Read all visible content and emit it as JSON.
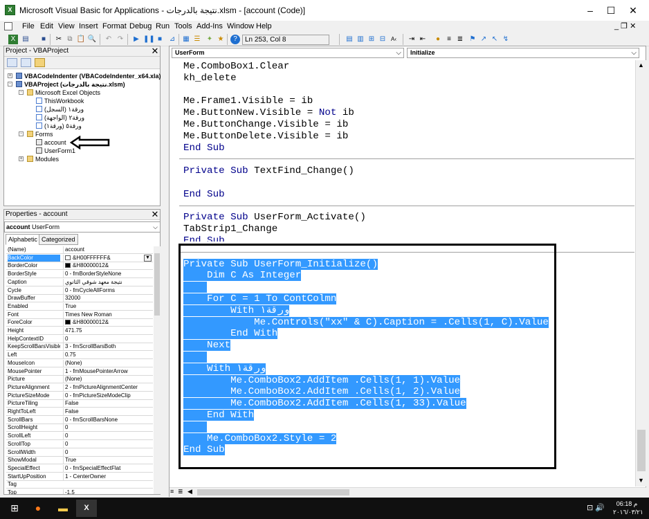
{
  "window": {
    "title": "Microsoft Visual Basic for Applications - نتيجة بالدرجات.xlsm - [account (Code)]",
    "icon_letter": "X",
    "controls": [
      "–",
      "☐",
      "✕"
    ]
  },
  "menubar": {
    "items": [
      "File",
      "Edit",
      "View",
      "Insert",
      "Format",
      "Debug",
      "Run",
      "Tools",
      "Add-Ins",
      "Window",
      "Help"
    ],
    "mdi_controls": "_ ❐ ✕"
  },
  "toolbar": {
    "position_text": "Ln 253, Col 8",
    "icons": [
      "excel-icon",
      "insert-icon",
      "save-icon",
      "cut-icon",
      "copy-icon",
      "paste-icon",
      "find-icon",
      "undo-icon",
      "redo-icon",
      "run-icon",
      "break-icon",
      "reset-icon",
      "design-mode-icon",
      "project-explorer-icon",
      "properties-icon",
      "object-browser-icon",
      "toolbox-icon",
      "help-icon"
    ]
  },
  "project_panel": {
    "title": "Project - VBAProject",
    "close": "✕",
    "tree": [
      {
        "label": "VBACodeIndenter (VBACodeIndenter_x64.xla)",
        "bold": true,
        "level": 0,
        "expander": "+",
        "icon": "project-icon"
      },
      {
        "label": "VBAProject (نتيجة بالدرجات.xlsm)",
        "bold": true,
        "level": 0,
        "expander": "-",
        "icon": "project-icon"
      },
      {
        "label": "Microsoft Excel Objects",
        "level": 1,
        "expander": "-",
        "icon": "folder-icon"
      },
      {
        "label": "ThisWorkbook",
        "level": 2,
        "icon": "workbook-icon"
      },
      {
        "label": "ورقة١ (السجل)",
        "level": 2,
        "icon": "sheet-icon"
      },
      {
        "label": "ورقة٢ (الواجهة)",
        "level": 2,
        "icon": "sheet-icon"
      },
      {
        "label": "ورقة٥ (ورقة١)",
        "level": 2,
        "icon": "sheet-icon"
      },
      {
        "label": "Forms",
        "level": 1,
        "expander": "-",
        "icon": "folder-icon"
      },
      {
        "label": "account",
        "level": 2,
        "icon": "userform-icon"
      },
      {
        "label": "UserForm1",
        "level": 2,
        "icon": "userform-icon"
      },
      {
        "label": "Modules",
        "level": 1,
        "expander": "+",
        "icon": "folder-icon"
      }
    ]
  },
  "properties_panel": {
    "title": "Properties - account",
    "close": "✕",
    "object_name": "account",
    "object_type": "UserForm",
    "tabs": [
      "Alphabetic",
      "Categorized"
    ],
    "rows": [
      {
        "name": "(Name)",
        "value": "account"
      },
      {
        "name": "BackColor",
        "value": "&H00FFFFFF&",
        "swatch": "#ffffff",
        "selected": true
      },
      {
        "name": "BorderColor",
        "value": "&H80000012&",
        "swatch": "#000000"
      },
      {
        "name": "BorderStyle",
        "value": "0 - fmBorderStyleNone"
      },
      {
        "name": "Caption",
        "value": "نتيجة معهد شوقي الثانوي"
      },
      {
        "name": "Cycle",
        "value": "0 - fmCycleAllForms"
      },
      {
        "name": "DrawBuffer",
        "value": "32000"
      },
      {
        "name": "Enabled",
        "value": "True"
      },
      {
        "name": "Font",
        "value": "Times New Roman"
      },
      {
        "name": "ForeColor",
        "value": "&H80000012&",
        "swatch": "#000000"
      },
      {
        "name": "Height",
        "value": "471.75"
      },
      {
        "name": "HelpContextID",
        "value": "0"
      },
      {
        "name": "KeepScrollBarsVisible",
        "value": "3 - fmScrollBarsBoth"
      },
      {
        "name": "Left",
        "value": "0.75"
      },
      {
        "name": "MouseIcon",
        "value": "(None)"
      },
      {
        "name": "MousePointer",
        "value": "1 - fmMousePointerArrow"
      },
      {
        "name": "Picture",
        "value": "(None)"
      },
      {
        "name": "PictureAlignment",
        "value": "2 - fmPictureAlignmentCenter"
      },
      {
        "name": "PictureSizeMode",
        "value": "0 - fmPictureSizeModeClip"
      },
      {
        "name": "PictureTiling",
        "value": "False"
      },
      {
        "name": "RightToLeft",
        "value": "False"
      },
      {
        "name": "ScrollBars",
        "value": "0 - fmScrollBarsNone"
      },
      {
        "name": "ScrollHeight",
        "value": "0"
      },
      {
        "name": "ScrollLeft",
        "value": "0"
      },
      {
        "name": "ScrollTop",
        "value": "0"
      },
      {
        "name": "ScrollWidth",
        "value": "0"
      },
      {
        "name": "ShowModal",
        "value": "True"
      },
      {
        "name": "SpecialEffect",
        "value": "0 - fmSpecialEffectFlat"
      },
      {
        "name": "StartUpPosition",
        "value": "1 - CenterOwner"
      },
      {
        "name": "Tag",
        "value": ""
      },
      {
        "name": "Top",
        "value": "-1.5"
      }
    ]
  },
  "code_window": {
    "object_combo": "UserForm",
    "procedure_combo": "Initialize",
    "lines": [
      {
        "text": "Me.ComboBox1.Clear"
      },
      {
        "text": "kh_delete"
      },
      {
        "text": ""
      },
      {
        "text": "Me.Frame1.Visible = ib"
      },
      {
        "text": "Me.ButtonNew.Visible = Not ib",
        "kw": "Not"
      },
      {
        "text": "Me.ButtonChange.Visible = ib"
      },
      {
        "text": "Me.ButtonDelete.Visible = ib"
      },
      {
        "text": "End Sub",
        "kwline": true
      },
      {
        "divider": true
      },
      {
        "text": "Private Sub TextFind_Change()",
        "kwprefix": "Private Sub"
      },
      {
        "text": ""
      },
      {
        "text": "End Sub",
        "kwline": true
      },
      {
        "divider": true
      },
      {
        "text": "Private Sub UserForm_Activate()",
        "kwprefix": "Private Sub"
      },
      {
        "text": "TabStrip1_Change"
      },
      {
        "text": "End Sub",
        "kwline": true,
        "clipped": true
      },
      {
        "divider": true
      },
      {
        "text": "Private Sub UserForm_Initialize()",
        "hl": true
      },
      {
        "text": "    Dim C As Integer",
        "hl": true
      },
      {
        "text": "    ",
        "hl": true
      },
      {
        "text": "    For C = 1 To ContColmn",
        "hl": true
      },
      {
        "text": "        With ورقة١",
        "hl": true
      },
      {
        "text": "            Me.Controls(\"xx\" & C).Caption = .Cells(1, C).Value",
        "hl": true
      },
      {
        "text": "        End With",
        "hl": true
      },
      {
        "text": "    Next",
        "hl": true
      },
      {
        "text": "    ",
        "hl": true
      },
      {
        "text": "    With ورقة١",
        "hl": true
      },
      {
        "text": "        Me.ComboBox2.AddItem .Cells(1, 1).Value",
        "hl": true
      },
      {
        "text": "        Me.ComboBox2.AddItem .Cells(1, 2).Value",
        "hl": true
      },
      {
        "text": "        Me.ComboBox2.AddItem .Cells(1, 33).Value",
        "hl": true
      },
      {
        "text": "    End With",
        "hl": true
      },
      {
        "text": "    ",
        "hl": true
      },
      {
        "text": "    Me.ComboBox2.Style = 2",
        "hl": true
      },
      {
        "text": "End Sub",
        "hl": true
      }
    ]
  },
  "taskbar": {
    "apps": [
      "windows-start-icon",
      "firefox-icon",
      "file-explorer-icon",
      "excel-icon"
    ],
    "clock_time": "06:18 م",
    "clock_date": "٢٠١٦/٠٣/٢١",
    "tray": "⊡ 🔊"
  }
}
